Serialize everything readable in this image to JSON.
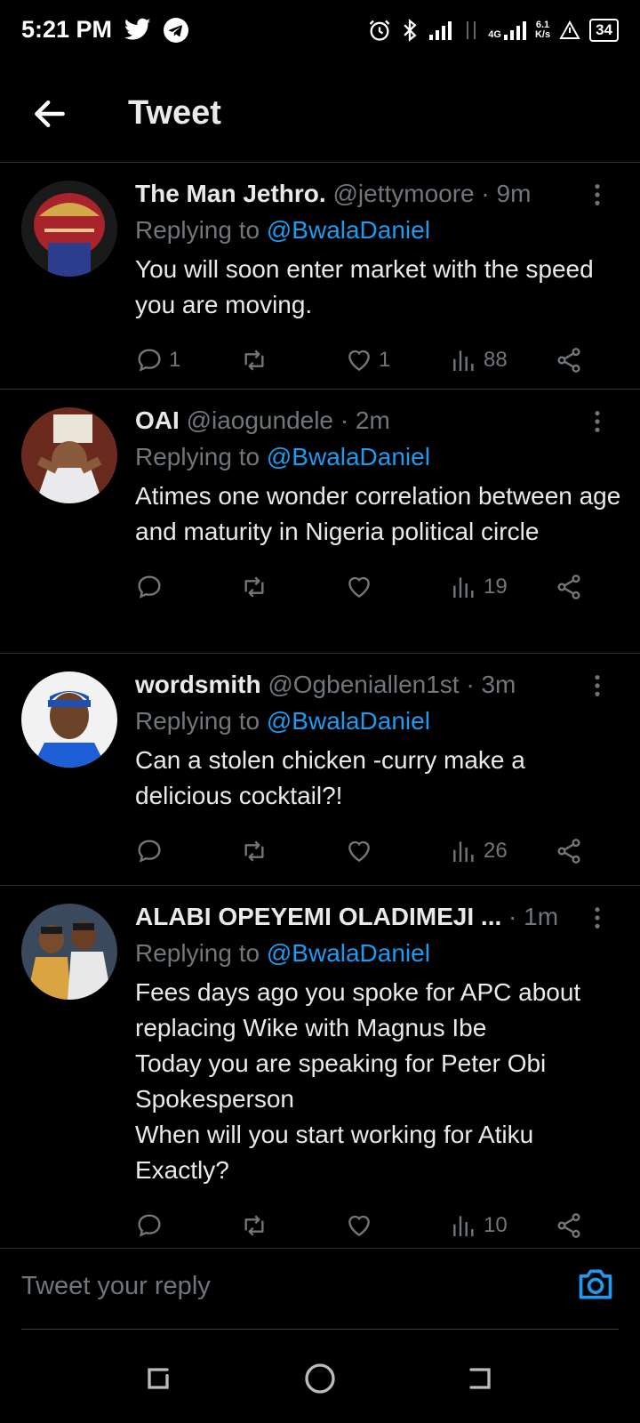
{
  "status_bar": {
    "time": "5:21 PM",
    "network_speed_top": "6.1",
    "network_speed_bottom": "K/s",
    "network_type": "4G",
    "battery": "34"
  },
  "header": {
    "title": "Tweet"
  },
  "tweets": [
    {
      "name": "The Man Jethro.",
      "handle": "@jettymoore",
      "time": "· 9m",
      "replying_prefix": "Replying to",
      "replying_to": "@BwalaDaniel",
      "text": "You will soon enter market with the speed you are moving.",
      "replies": "1",
      "retweets": "",
      "likes": "1",
      "views": "88"
    },
    {
      "name": "OAI",
      "handle": "@iaogundele",
      "time": "· 2m",
      "replying_prefix": "Replying to",
      "replying_to": "@BwalaDaniel",
      "text": "Atimes one wonder correlation between age and maturity in Nigeria political circle",
      "replies": "",
      "retweets": "",
      "likes": "",
      "views": "19"
    },
    {
      "name": "wordsmith",
      "handle": "@Ogbeniallen1st",
      "time": "· 3m",
      "replying_prefix": "Replying to",
      "replying_to": "@BwalaDaniel",
      "text": "Can a stolen chicken -curry make a delicious cocktail?!",
      "replies": "",
      "retweets": "",
      "likes": "",
      "views": "26"
    },
    {
      "name": "ALABI OPEYEMI OLADIMEJI ...",
      "handle": "",
      "time": "· 1m",
      "replying_prefix": "Replying to",
      "replying_to": "@BwalaDaniel",
      "text": "Fees days ago you spoke for APC about replacing Wike with Magnus Ibe\nToday you are speaking for Peter Obi Spokesperson\nWhen will you start working for Atiku Exactly?",
      "replies": "",
      "retweets": "",
      "likes": "",
      "views": "10"
    }
  ],
  "reply_bar": {
    "placeholder": "Tweet your reply"
  },
  "colors": {
    "accent": "#1d9bf0",
    "background": "#000000",
    "muted": "#71767b",
    "divider": "#2f3336"
  }
}
